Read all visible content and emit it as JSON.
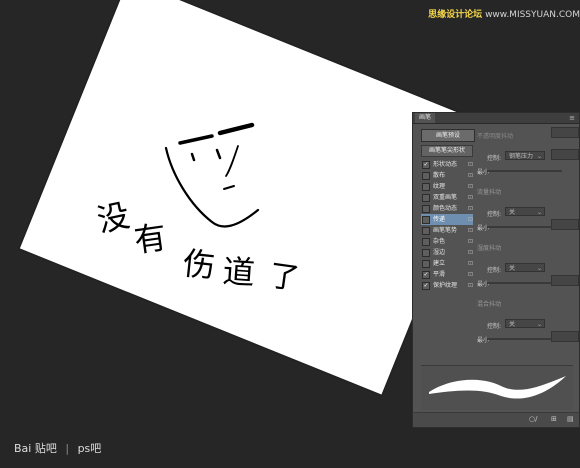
{
  "watermark": {
    "prefix": "思缘设计论坛",
    "url": "www.MISSYUAN.COM"
  },
  "canvas_text": {
    "char1": "没",
    "char2": "有",
    "char3": "伤",
    "char4": "道",
    "char5": "了"
  },
  "brush_panel": {
    "tab_title": "画笔",
    "preset_button": "画笔预设",
    "tip_header": "画笔笔尖形状",
    "items": [
      {
        "label": "形状动态",
        "checked": true,
        "selected": false
      },
      {
        "label": "散布",
        "checked": false,
        "selected": false
      },
      {
        "label": "纹理",
        "checked": false,
        "selected": false
      },
      {
        "label": "双重画笔",
        "checked": false,
        "selected": false
      },
      {
        "label": "颜色动态",
        "checked": false,
        "selected": false
      },
      {
        "label": "传递",
        "checked": false,
        "selected": true
      },
      {
        "label": "画笔笔势",
        "checked": false,
        "selected": false
      },
      {
        "label": "杂色",
        "checked": false,
        "selected": false
      },
      {
        "label": "湿边",
        "checked": false,
        "selected": false
      },
      {
        "label": "建立",
        "checked": false,
        "selected": false
      },
      {
        "label": "平滑",
        "checked": true,
        "selected": false
      },
      {
        "label": "保护纹理",
        "checked": true,
        "selected": false
      }
    ],
    "settings": {
      "opacity_jitter": "不透明度抖动",
      "control_label": "控制:",
      "control_value_pen_pressure": "钢笔压力",
      "control_value_off": "关",
      "minimum_label": "最小",
      "flow_jitter": "流量抖动",
      "wetness_jitter": "湿度抖动",
      "mix_jitter": "混合抖动"
    },
    "footer": {
      "icon_a": "○/",
      "icon_b": "⊞",
      "icon_c": "▤"
    }
  },
  "baidu": {
    "brand": "Bai 贴吧",
    "forum": "ps吧"
  }
}
